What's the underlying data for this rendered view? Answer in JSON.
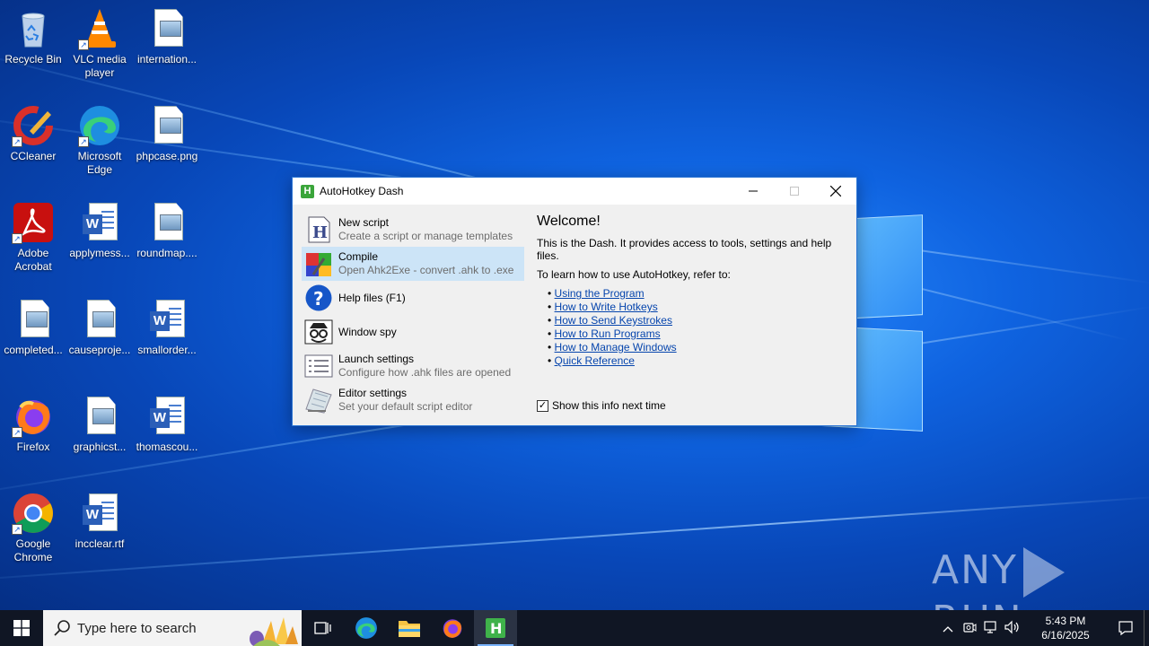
{
  "desktop": {
    "icons": [
      {
        "label": "Recycle Bin"
      },
      {
        "label": "VLC media player"
      },
      {
        "label": "internation..."
      },
      {
        "label": "CCleaner"
      },
      {
        "label": "Microsoft Edge"
      },
      {
        "label": "phpcase.png"
      },
      {
        "label": "Adobe Acrobat"
      },
      {
        "label": "applymess..."
      },
      {
        "label": "roundmap...."
      },
      {
        "label": "completed..."
      },
      {
        "label": "causeproje..."
      },
      {
        "label": "smallorder..."
      },
      {
        "label": "Firefox"
      },
      {
        "label": "graphicst..."
      },
      {
        "label": "thomascou..."
      },
      {
        "label": "Google Chrome"
      },
      {
        "label": "incclear.rtf"
      }
    ],
    "watermark": {
      "left": "ANY",
      "right": "RUN"
    }
  },
  "window": {
    "title": "AutoHotkey Dash",
    "menu": [
      {
        "title": "New script",
        "subtitle": "Create a script or manage templates"
      },
      {
        "title": "Compile",
        "subtitle": "Open Ahk2Exe - convert .ahk to .exe"
      },
      {
        "title": "Help files (F1)",
        "subtitle": ""
      },
      {
        "title": "Window spy",
        "subtitle": ""
      },
      {
        "title": "Launch settings",
        "subtitle": "Configure how .ahk files are opened"
      },
      {
        "title": "Editor settings",
        "subtitle": "Set your default script editor"
      }
    ],
    "welcome": "Welcome!",
    "intro": "This is the Dash. It provides access to tools, settings and help files.",
    "learn": "To learn how to use AutoHotkey, refer to:",
    "links": [
      "Using the Program",
      "How to Write Hotkeys",
      "How to Send Keystrokes",
      "How to Run Programs",
      "How to Manage Windows",
      "Quick Reference"
    ],
    "show_info_label": "Show this info next time",
    "show_info_checked": true
  },
  "taskbar": {
    "search_placeholder": "Type here to search",
    "time": "5:43 PM",
    "date": "6/16/2025"
  },
  "colors": {
    "accent": "#2a74d4",
    "link": "#0645ad",
    "selected": "#cce4f7",
    "taskbar": "#101624"
  }
}
